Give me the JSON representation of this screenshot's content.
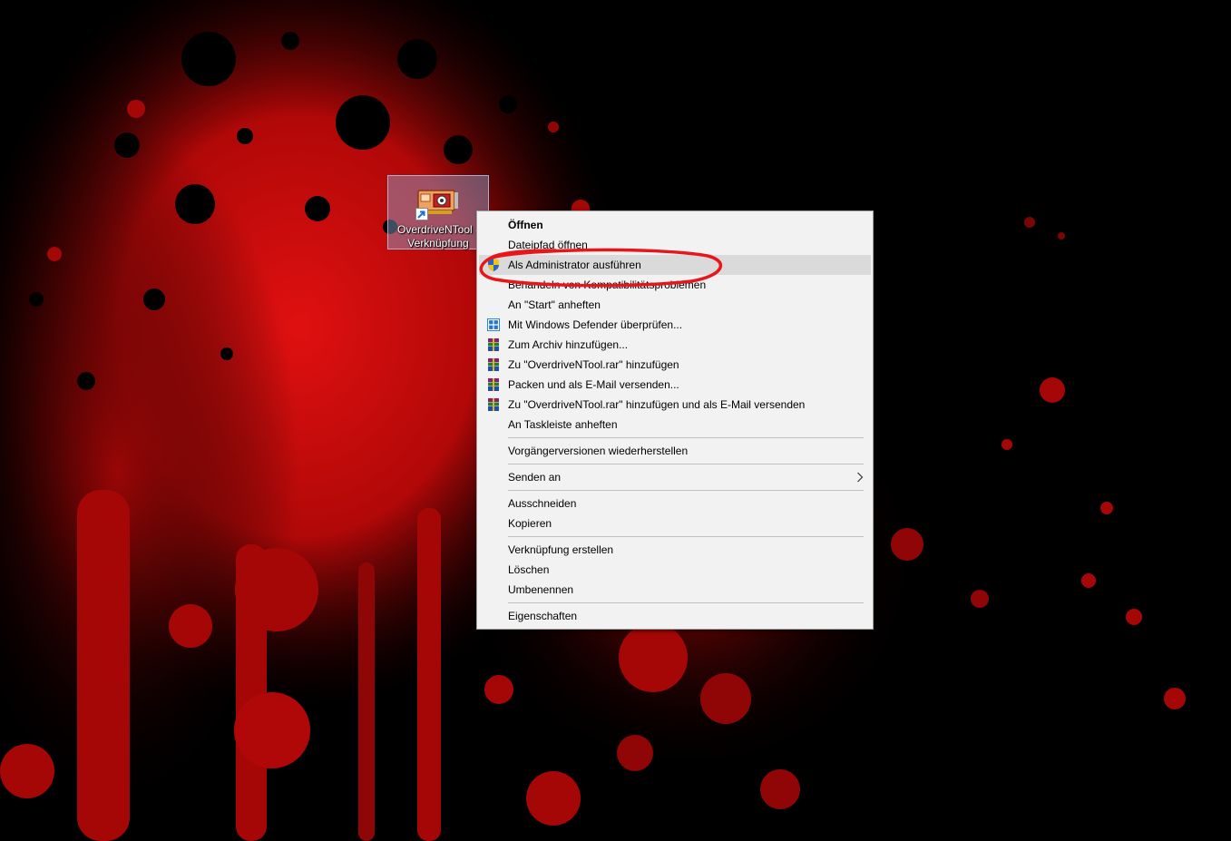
{
  "desktop": {
    "shortcut": {
      "label_line1": "OverdriveNTool -",
      "label_line2": "Verknüpfung",
      "icon": "graphics-card-icon",
      "overlay_icon": "shortcut-arrow-icon"
    }
  },
  "context_menu": {
    "items": [
      {
        "label": "Öffnen",
        "icon": ""
      },
      {
        "label": "Dateipfad öffnen",
        "icon": ""
      },
      {
        "label": "Als Administrator ausführen",
        "icon": "uac-shield-icon"
      },
      {
        "label": "Behandeln von Kompatibilitätsproblemen",
        "icon": ""
      },
      {
        "label": "An \"Start\" anheften",
        "icon": ""
      },
      {
        "label": "Mit Windows Defender überprüfen...",
        "icon": "windows-defender-icon"
      },
      {
        "label": "Zum Archiv hinzufügen...",
        "icon": "winrar-icon"
      },
      {
        "label": "Zu \"OverdriveNTool.rar\" hinzufügen",
        "icon": "winrar-icon"
      },
      {
        "label": "Packen und als E-Mail versenden...",
        "icon": "winrar-icon"
      },
      {
        "label": "Zu \"OverdriveNTool.rar\" hinzufügen und als E-Mail versenden",
        "icon": "winrar-icon"
      },
      {
        "label": "An Taskleiste anheften",
        "icon": ""
      },
      {
        "label": "Vorgängerversionen wiederherstellen",
        "icon": ""
      },
      {
        "label": "Senden an",
        "icon": "chevron-right-icon"
      },
      {
        "label": "Ausschneiden",
        "icon": ""
      },
      {
        "label": "Kopieren",
        "icon": ""
      },
      {
        "label": "Verknüpfung erstellen",
        "icon": ""
      },
      {
        "label": "Löschen",
        "icon": ""
      },
      {
        "label": "Umbenennen",
        "icon": ""
      },
      {
        "label": "Eigenschaften",
        "icon": ""
      }
    ],
    "highlighted_item": "Als Administrator ausführen"
  },
  "annotation": {
    "color": "#e8161b",
    "shape": "hand-drawn-ellipse"
  },
  "colors": {
    "wallpaper_base": "#000000",
    "wallpaper_splatter": "#c40a0a",
    "menu_background": "#f2f2f2",
    "menu_highlight": "#dadada"
  }
}
